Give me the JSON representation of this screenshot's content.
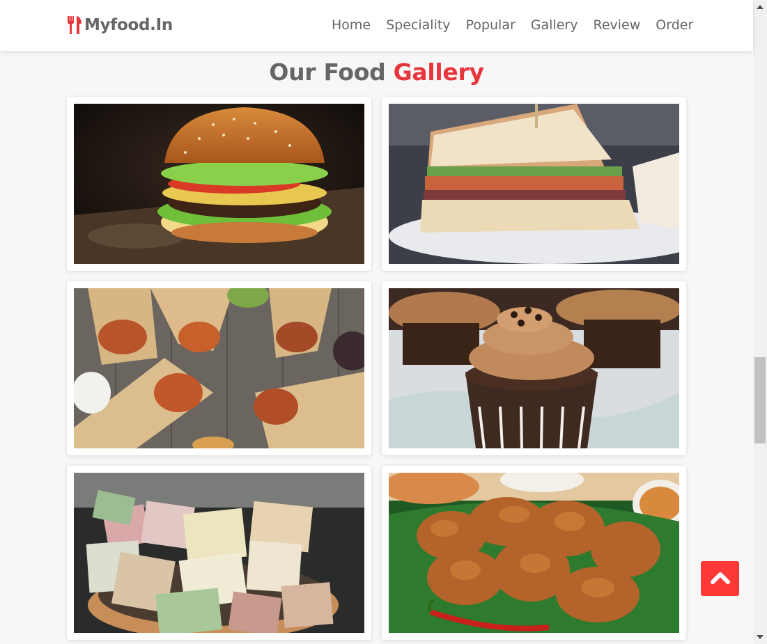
{
  "header": {
    "logo_text": "Myfood.In",
    "logo_icon": "utensils-icon",
    "nav": [
      {
        "label": "Home"
      },
      {
        "label": "Speciality"
      },
      {
        "label": "Popular"
      },
      {
        "label": "Gallery"
      },
      {
        "label": "Review"
      },
      {
        "label": "Order"
      }
    ]
  },
  "gallery": {
    "title_part1": "Our Food",
    "title_part2": "Gallery",
    "items": [
      {
        "image": "burger photo"
      },
      {
        "image": "sandwich photo"
      },
      {
        "image": "wraps photo"
      },
      {
        "image": "cupcakes photo"
      },
      {
        "image": "paneer cubes photo"
      },
      {
        "image": "fried chicken photo"
      }
    ]
  },
  "scroll_to_top": {
    "icon": "chevron-up-icon"
  },
  "colors": {
    "accent": "#e8343d",
    "button": "#ff3838",
    "text": "#666666",
    "background": "#f7f7f7"
  }
}
